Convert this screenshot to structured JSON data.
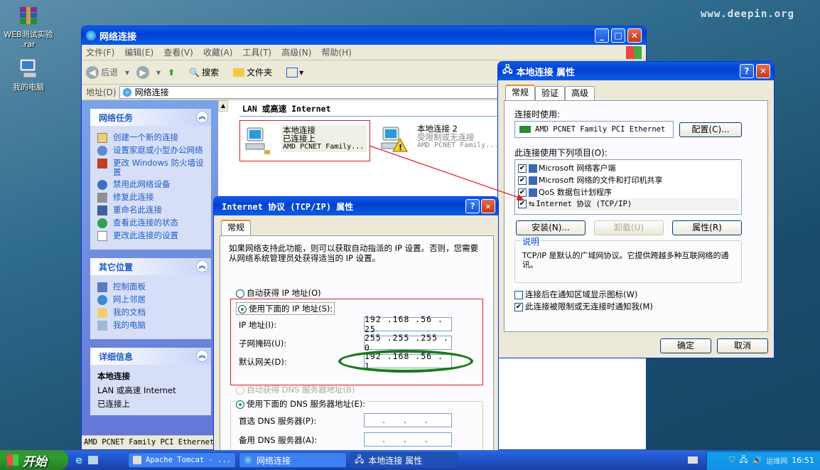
{
  "desktop": {
    "brand": "www.deepin.org",
    "icons": [
      {
        "label": "WEB测试实验 .rar"
      },
      {
        "label": "我的电脑"
      }
    ]
  },
  "explorer": {
    "title": "网络连接",
    "menu": [
      "文件(F)",
      "编辑(E)",
      "查看(V)",
      "收藏(A)",
      "工具(T)",
      "高级(N)",
      "帮助(H)"
    ],
    "toolbar": {
      "back": "后退",
      "search": "搜索",
      "folders": "文件夹"
    },
    "address_label": "地址(D)",
    "address_value": "网络连接",
    "tasks_title": "网络任务",
    "tasks": [
      "创建一个新的连接",
      "设置家庭或小型办公网络",
      "更改 Windows 防火墙设置",
      "禁用此网络设备",
      "修复此连接",
      "重命名此连接",
      "查看此连接的状态",
      "更改此连接的设置"
    ],
    "other_title": "其它位置",
    "other": [
      "控制面板",
      "网上邻居",
      "我的文档",
      "我的电脑"
    ],
    "details_title": "详细信息",
    "details_name": "本地连接",
    "details_type": "LAN 或高速 Internet",
    "details_status": "已连接上",
    "group_header": "LAN 或高速 Internet",
    "conn1": {
      "name": "本地连接",
      "status": "已连接上",
      "device": "AMD PCNET Family..."
    },
    "conn2": {
      "name": "本地连接 2",
      "status": "受限制或无连接",
      "device": "AMD PCNET Family..."
    },
    "statusbar": "AMD PCNET Family PCI Ethernet"
  },
  "props": {
    "title": "本地连接 属性",
    "tabs": [
      "常规",
      "验证",
      "高级"
    ],
    "connect_using": "连接时使用:",
    "adapter": "AMD PCNET Family PCI Ethernet",
    "config_btn": "配置(C)...",
    "items_label": "此连接使用下列项目(O):",
    "items": [
      "Microsoft 网络客户端",
      "Microsoft 网络的文件和打印机共享",
      "QoS 数据包计划程序",
      "Internet 协议 (TCP/IP)"
    ],
    "install_btn": "安装(N)...",
    "uninstall_btn": "卸载(U)",
    "properties_btn": "属性(R)",
    "desc_title": "说明",
    "desc_text": "TCP/IP 是默认的广域网协议。它提供跨越多种互联网络的通讯。",
    "notify_icon": "连接后在通知区域显示图标(W)",
    "notify_limited": "此连接被限制或无连接时通知我(M)",
    "ok": "确定",
    "cancel": "取消"
  },
  "tcpip": {
    "title": "Internet 协议 (TCP/IP) 属性",
    "tab": "常规",
    "intro": "如果网络支持此功能，则可以获取自动指派的 IP 设置。否则，您需要从网络系统管理员处获得适当的 IP 设置。",
    "auto_ip": "自动获得 IP 地址(O)",
    "manual_ip": "使用下面的 IP 地址(S):",
    "ip_label": "IP 地址(I):",
    "ip": "192 .168 .56 . 25",
    "mask_label": "子网掩码(U):",
    "mask": "255 .255 .255 . 0",
    "gw_label": "默认网关(D):",
    "gw": "192 .168 .56 . 1",
    "auto_dns": "自动获得 DNS 服务器地址(B)",
    "manual_dns": "使用下面的 DNS 服务器地址(E):",
    "dns1_label": "首选 DNS 服务器(P):",
    "dns2_label": "备用 DNS 服务器(A):",
    "dns_blank": ". . ."
  },
  "taskbar": {
    "start": "开始",
    "tasks": [
      "Apache Tomcat - ...",
      "网络连接",
      "本地连接 属性"
    ],
    "clock": "16:51",
    "watermark": "运维网"
  }
}
